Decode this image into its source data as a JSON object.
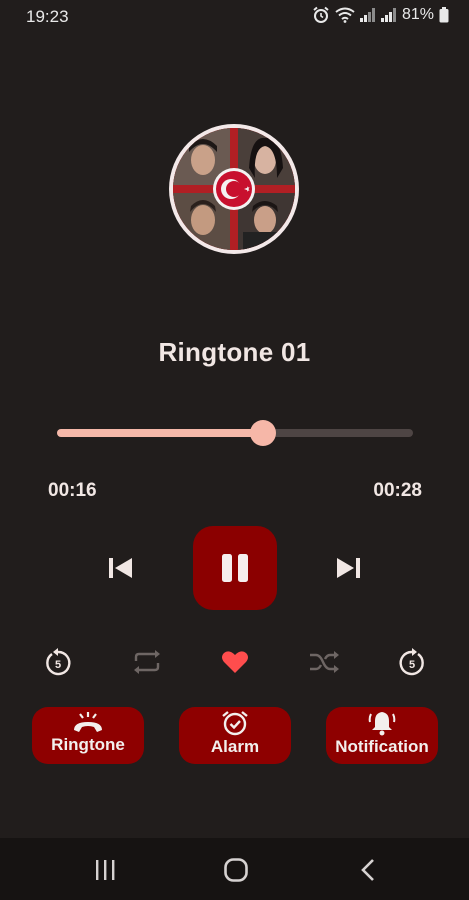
{
  "status_bar": {
    "time": "19:23",
    "battery": "81%",
    "icons": [
      "alarm-icon",
      "wifi-icon",
      "signal-icon",
      "signal-icon",
      "battery-icon"
    ]
  },
  "player": {
    "title": "Ringtone 01",
    "current_time": "00:16",
    "total_time": "00:28",
    "progress": 0.58,
    "cover_icon": "album-cover-turkish-flag"
  },
  "controls": {
    "prev_icon": "skip-previous-icon",
    "play_pause_icon": "pause-icon",
    "next_icon": "skip-next-icon"
  },
  "secondary_controls": [
    {
      "name": "rewind-5-icon",
      "label": "5"
    },
    {
      "name": "repeat-icon"
    },
    {
      "name": "favorite-heart-icon"
    },
    {
      "name": "shuffle-icon"
    },
    {
      "name": "forward-5-icon",
      "label": "5"
    }
  ],
  "actions": {
    "ringtone_label": "Ringtone",
    "alarm_label": "Alarm",
    "notification_label": "Notification"
  },
  "colors": {
    "background": "#211d1c",
    "accent": "#8b0000",
    "slider": "#f5b8a9",
    "heart": "#ff4d4d"
  },
  "nav_bar": [
    "recent-apps-icon",
    "home-icon",
    "back-icon"
  ]
}
